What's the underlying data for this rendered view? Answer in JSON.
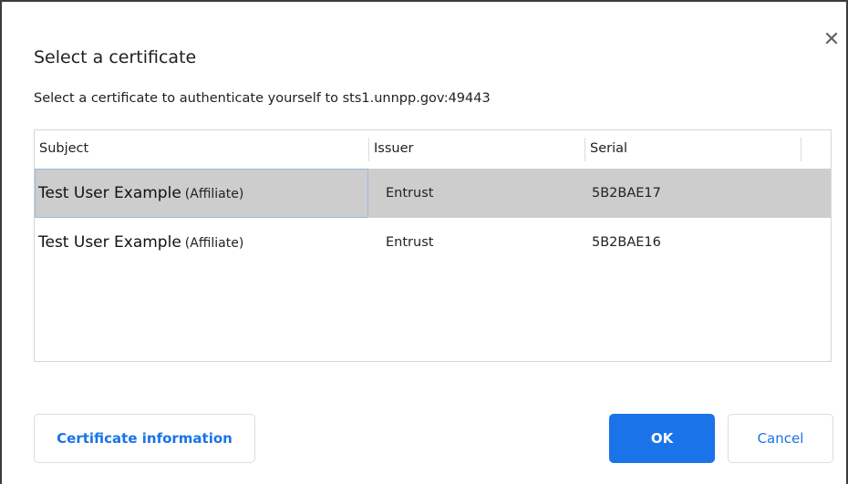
{
  "dialog": {
    "title": "Select a certificate",
    "close_symbol": "✕",
    "subtitle": "Select a certificate to authenticate yourself to sts1.unnpp.gov:49443"
  },
  "table": {
    "columns": [
      "Subject",
      "Issuer",
      "Serial"
    ],
    "rows": [
      {
        "name": "Test User Example",
        "affiliation": "(Affiliate)",
        "issuer": "Entrust",
        "serial": "5B2BAE17",
        "selected": true
      },
      {
        "name": "Test User Example",
        "affiliation": "(Affiliate)",
        "issuer": "Entrust",
        "serial": "5B2BAE16",
        "selected": false
      }
    ]
  },
  "buttons": {
    "certificate_info": "Certificate information",
    "ok": "OK",
    "cancel": "Cancel"
  },
  "colors": {
    "accent": "#1a73e8",
    "selected_row": "#cdcdcd",
    "focus_border": "#99b9e3"
  },
  "icons": {
    "close": "close-icon"
  }
}
